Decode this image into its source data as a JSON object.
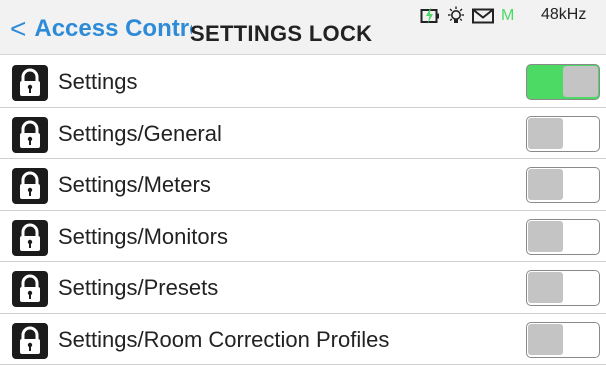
{
  "header": {
    "back_label": "Access Control",
    "title": "SETTINGS LOCK",
    "status": {
      "icons": [
        "battery-charging-icon",
        "lightbulb-icon",
        "mail-icon"
      ],
      "mode_badge": "M",
      "sample_rate": "48kHz"
    }
  },
  "colors": {
    "accent": "#2e8bd8",
    "toggle_on": "#4cd964",
    "toggle_off_knob": "#c4c4c4"
  },
  "locks": [
    {
      "label": "Settings",
      "enabled": true
    },
    {
      "label": "Settings/General",
      "enabled": false
    },
    {
      "label": "Settings/Meters",
      "enabled": false
    },
    {
      "label": "Settings/Monitors",
      "enabled": false
    },
    {
      "label": "Settings/Presets",
      "enabled": false
    },
    {
      "label": "Settings/Room Correction Profiles",
      "enabled": false
    }
  ]
}
